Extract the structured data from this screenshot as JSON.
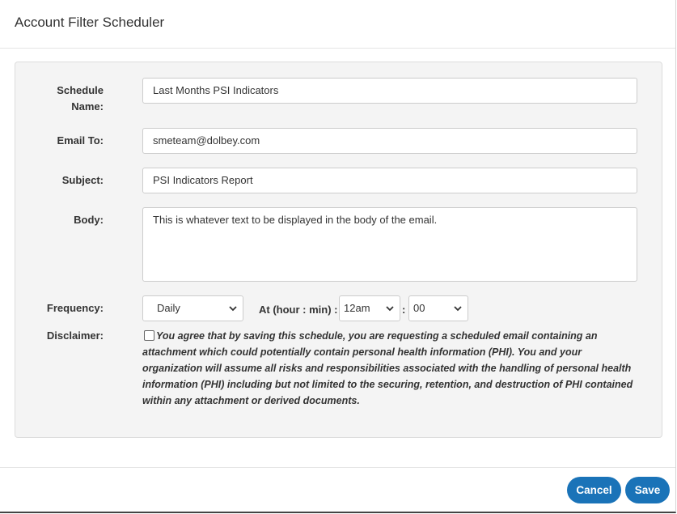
{
  "dialog": {
    "title": "Account Filter Scheduler"
  },
  "form": {
    "schedule_name": {
      "label": "Schedule Name:",
      "value": "Last Months PSI Indicators"
    },
    "email_to": {
      "label": "Email To:",
      "value": "smeteam@dolbey.com"
    },
    "subject": {
      "label": "Subject:",
      "value": "PSI Indicators Report"
    },
    "body": {
      "label": "Body:",
      "value": "This is whatever text to be displayed in the body of the email."
    },
    "frequency": {
      "label": "Frequency:",
      "value": "Daily"
    },
    "at_label": "At (hour : min) :",
    "hour": "12am",
    "colon": ":",
    "minute": "00",
    "disclaimer": {
      "label": "Disclaimer:",
      "checked": false,
      "text": "You agree that by saving this schedule, you are requesting a scheduled email containing an attachment which could potentially contain personal health information (PHI). You and your organization will assume all risks and responsibilities associated with the handling of personal health information (PHI) including but not limited to the securing, retention, and destruction of PHI contained within any attachment or derived documents."
    }
  },
  "footer": {
    "cancel_label": "Cancel",
    "save_label": "Save"
  },
  "colors": {
    "primary_button": "#1a73b8",
    "panel_bg": "#f4f4f4"
  },
  "icons": {
    "select_arrow": "chevron-down-icon"
  }
}
